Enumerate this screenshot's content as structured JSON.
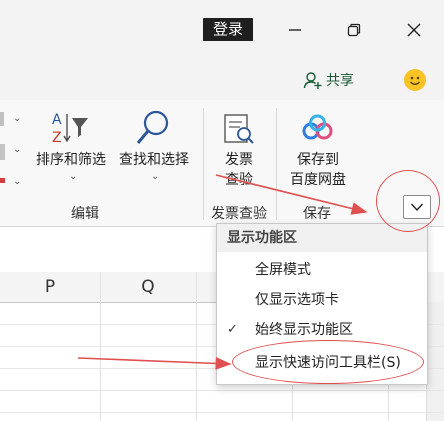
{
  "titlebar": {
    "login_label": "登录",
    "minimize_icon": "minimize-icon",
    "restore_icon": "restore-icon",
    "close_icon": "close-icon"
  },
  "share": {
    "label": "共享"
  },
  "ribbon": {
    "sort_filter_label": "排序和筛选",
    "find_select_label": "查找和选择",
    "invoice_check_line1": "发票",
    "invoice_check_line2": "查验",
    "save_to_line1": "保存到",
    "save_to_line2": "百度网盘",
    "groups": {
      "edit": "编辑",
      "invoice": "发票查验",
      "save": "保存"
    }
  },
  "sheet": {
    "columns": [
      "P",
      "Q"
    ]
  },
  "menu": {
    "header": "显示功能区",
    "items": [
      {
        "label": "全屏模式",
        "checked": false
      },
      {
        "label": "仅显示选项卡",
        "checked": false
      },
      {
        "label": "始终显示功能区",
        "checked": true
      },
      {
        "label": "显示快速访问工具栏(S)",
        "checked": false
      }
    ],
    "check_glyph": "✓"
  },
  "colors": {
    "accent_green": "#185c37",
    "annotation_red": "#e05050"
  }
}
